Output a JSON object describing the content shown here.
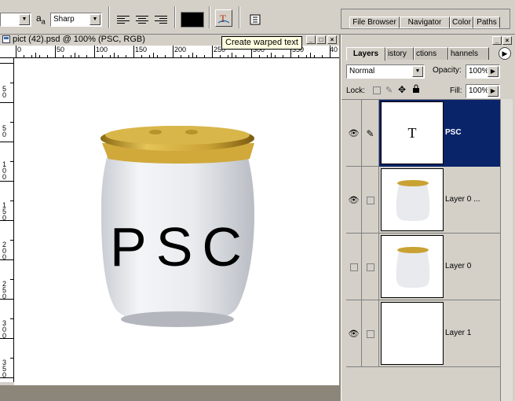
{
  "options_bar": {
    "aa_label": "a",
    "aa_label_sub": "a",
    "antialias_value": "Sharp"
  },
  "palette_well": {
    "tabs": [
      "File Browser",
      "Navigator",
      "Color",
      "Paths"
    ]
  },
  "document": {
    "title": "pict (42).psd @ 100% (PSC, RGB)",
    "hruler": [
      "0",
      "50",
      "100",
      "150",
      "200",
      "250",
      "300",
      "350",
      "40"
    ],
    "vruler": [
      "5",
      "0",
      "5",
      "0",
      "1",
      "0",
      "0",
      "1",
      "5",
      "0",
      "2",
      "0",
      "0",
      "2",
      "5",
      "0",
      "3",
      "0",
      "0",
      "3",
      "5",
      "0",
      "4"
    ],
    "canvas_text": "PSC"
  },
  "tooltip": "Create warped text",
  "layers_palette": {
    "tabs": [
      "Layers",
      "istory",
      "ctions",
      "hannels"
    ],
    "blend_mode": "Normal",
    "opacity_label": "Opacity:",
    "opacity_value": "100%",
    "lock_label": "Lock:",
    "fill_label": "Fill:",
    "fill_value": "100%",
    "type_thumb_glyph": "T",
    "layers": [
      {
        "name": "PSC",
        "visible": true
      },
      {
        "name": "Layer 0 ...",
        "visible": true
      },
      {
        "name": "Layer 0",
        "visible": false
      },
      {
        "name": "Layer 1",
        "visible": true
      }
    ]
  },
  "colors": {
    "selected_layer": "#0a246a",
    "chrome": "#d4d0c8",
    "foreground_swatch": "#000000",
    "lid_gold": "#c9a233"
  }
}
